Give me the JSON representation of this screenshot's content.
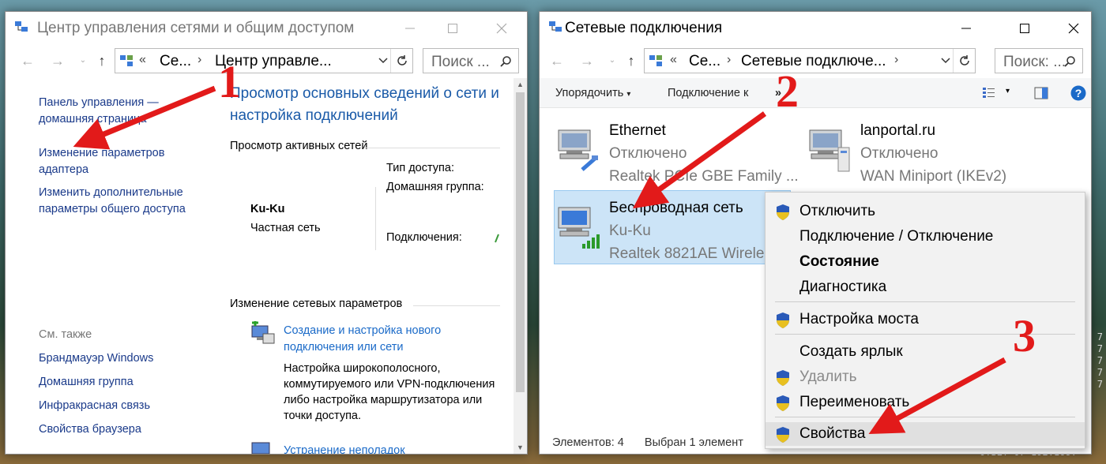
{
  "window1": {
    "title": "Центр управления сетями и общим доступом",
    "breadcrumbs": [
      "Се...",
      "Центр управле..."
    ],
    "search_placeholder": "Поиск ...",
    "sidebar": {
      "home_link": "Панель управления — домашняя страница",
      "adapter_link": "Изменение параметров адаптера",
      "sharing_link": "Изменить дополнительные параметры общего доступа",
      "see_also_label": "См. также",
      "see_also": [
        "Брандмауэр Windows",
        "Домашняя группа",
        "Инфракрасная связь",
        "Свойства браузера"
      ]
    },
    "main_title": "Просмотр основных сведений о сети и настройка подключений",
    "active_networks_header": "Просмотр активных сетей",
    "network": {
      "name": "Ku-Ku",
      "type": "Частная сеть",
      "access_type_label": "Тип доступа:",
      "homegroup_label": "Домашняя группа:",
      "connections_label": "Подключения:"
    },
    "change_settings_header": "Изменение сетевых параметров",
    "tasks": [
      {
        "title": "Создание и настройка нового подключения или сети",
        "desc": "Настройка широкополосного, коммутируемого или VPN-подключения либо настройка маршрутизатора или точки доступа."
      },
      {
        "title": "Устранение неполадок"
      }
    ]
  },
  "window2": {
    "title": "Сетевые подключения",
    "breadcrumbs": [
      "Се...",
      "Сетевые подключе..."
    ],
    "search_placeholder": "Поиск: ...",
    "toolbar": {
      "organize": "Упорядочить",
      "connect_to": "Подключение к",
      "more": "»"
    },
    "connections": [
      {
        "name": "Ethernet",
        "status": "Отключено",
        "device": "Realtek PCIe GBE Family ..."
      },
      {
        "name": "lanportal.ru",
        "status": "Отключено",
        "device": "WAN Miniport (IKEv2)"
      },
      {
        "name": "Беспроводная сеть",
        "status": "Ku-Ku",
        "device": "Realtek 8821AE Wireles"
      }
    ],
    "status_items": "Элементов: 4",
    "status_selected": "Выбран 1 элемент"
  },
  "context_menu": [
    {
      "label": "Отключить",
      "shield": true
    },
    {
      "label": "Подключение / Отключение",
      "shield": false
    },
    {
      "label": "Состояние",
      "shield": false,
      "bold": true
    },
    {
      "label": "Диагностика",
      "shield": false
    },
    {
      "label": "Настройка моста",
      "shield": true
    },
    {
      "label": "Создать ярлык",
      "shield": false
    },
    {
      "label": "Удалить",
      "shield": true,
      "disabled": true
    },
    {
      "label": "Переименовать",
      "shield": true
    },
    {
      "label": "Свойства",
      "shield": true,
      "highlighted": true
    }
  ],
  "annotations": [
    "1",
    "2",
    "3"
  ],
  "background_text": {
    "side": "7\n7\n7\n7\n7",
    "bottom": "OTBET 07 192.168."
  }
}
